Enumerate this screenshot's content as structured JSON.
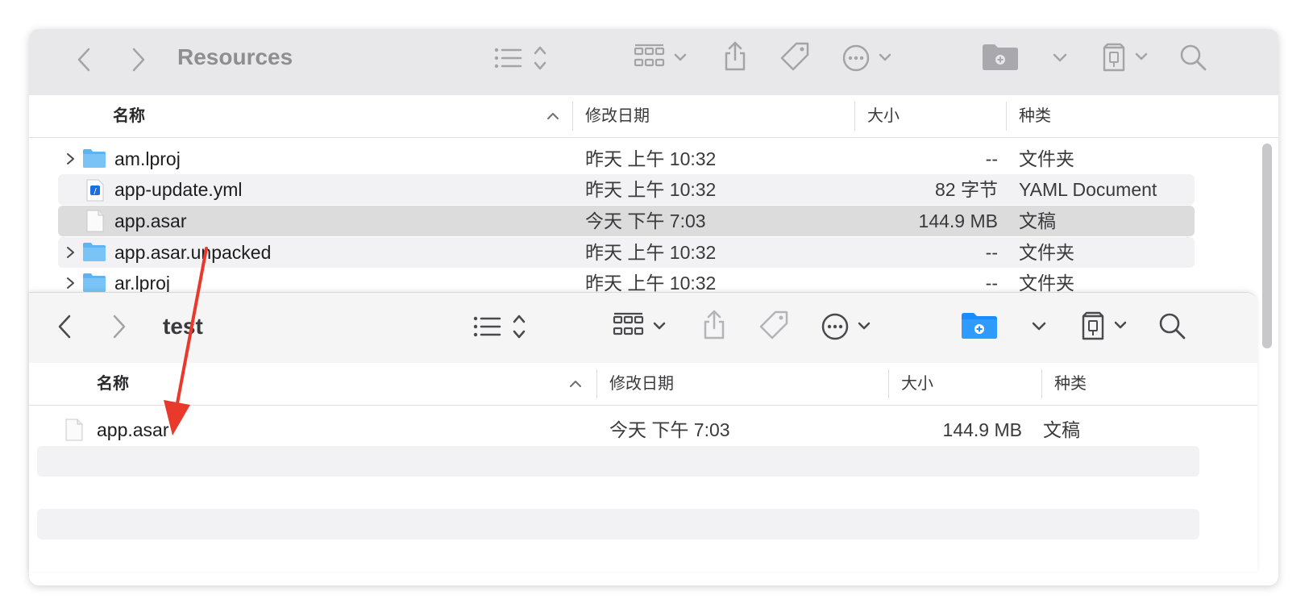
{
  "back_window": {
    "title": "Resources",
    "columns": {
      "name": "名称",
      "date": "修改日期",
      "size": "大小",
      "kind": "种类"
    },
    "rows": [
      {
        "name": "am.lproj",
        "date": "昨天 上午 10:32",
        "size": "--",
        "kind": "文件夹",
        "icon": "folder-icon",
        "expandable": true
      },
      {
        "name": "app-update.yml",
        "date": "昨天 上午 10:32",
        "size": "82 字节",
        "kind": "YAML Document",
        "icon": "yaml-file-icon",
        "expandable": false
      },
      {
        "name": "app.asar",
        "date": "今天 下午 7:03",
        "size": "144.9 MB",
        "kind": "文稿",
        "icon": "document-icon",
        "expandable": false
      },
      {
        "name": "app.asar.unpacked",
        "date": "昨天 上午 10:32",
        "size": "--",
        "kind": "文件夹",
        "icon": "folder-icon",
        "expandable": true
      },
      {
        "name": "ar.lproj",
        "date": "昨天 上午 10:32",
        "size": "--",
        "kind": "文件夹",
        "icon": "folder-icon",
        "expandable": true
      }
    ]
  },
  "front_window": {
    "title": "test",
    "columns": {
      "name": "名称",
      "date": "修改日期",
      "size": "大小",
      "kind": "种类"
    },
    "rows": [
      {
        "name": "app.asar",
        "date": "今天 下午 7:03",
        "size": "144.9 MB",
        "kind": "文稿",
        "icon": "document-icon"
      }
    ]
  },
  "colors": {
    "accent_folder": "#1a8cff",
    "annotation_arrow": "#e8392b"
  },
  "annotation": {
    "type": "arrow",
    "from": "back_window.rows.3",
    "to": "front_window.rows.0"
  }
}
